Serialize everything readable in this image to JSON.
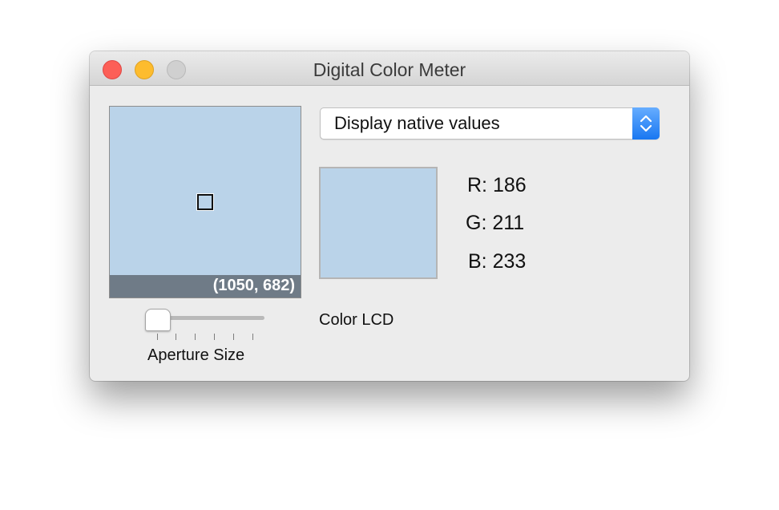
{
  "window": {
    "title": "Digital Color Meter"
  },
  "magnifier": {
    "coordinates": "(1050, 682)",
    "sampled_color": "#bad3e9"
  },
  "aperture": {
    "label": "Aperture Size",
    "level": 0
  },
  "display_mode": {
    "selected": "Display native values"
  },
  "color": {
    "swatch": "#bad3e9",
    "r_label": "R:",
    "r_value": "186",
    "g_label": "G:",
    "g_value": "211",
    "b_label": "B:",
    "b_value": "233"
  },
  "display_name": "Color LCD",
  "icons": {
    "close": "close-traffic-light",
    "minimize": "minimize-traffic-light",
    "zoom": "zoom-traffic-light",
    "popup": "up-down-chevron-icon"
  },
  "colors": {
    "close": "#fc5f57",
    "minimize": "#fdbc2e",
    "zoom": "#d0d0d0",
    "accent": "#1877f1"
  }
}
